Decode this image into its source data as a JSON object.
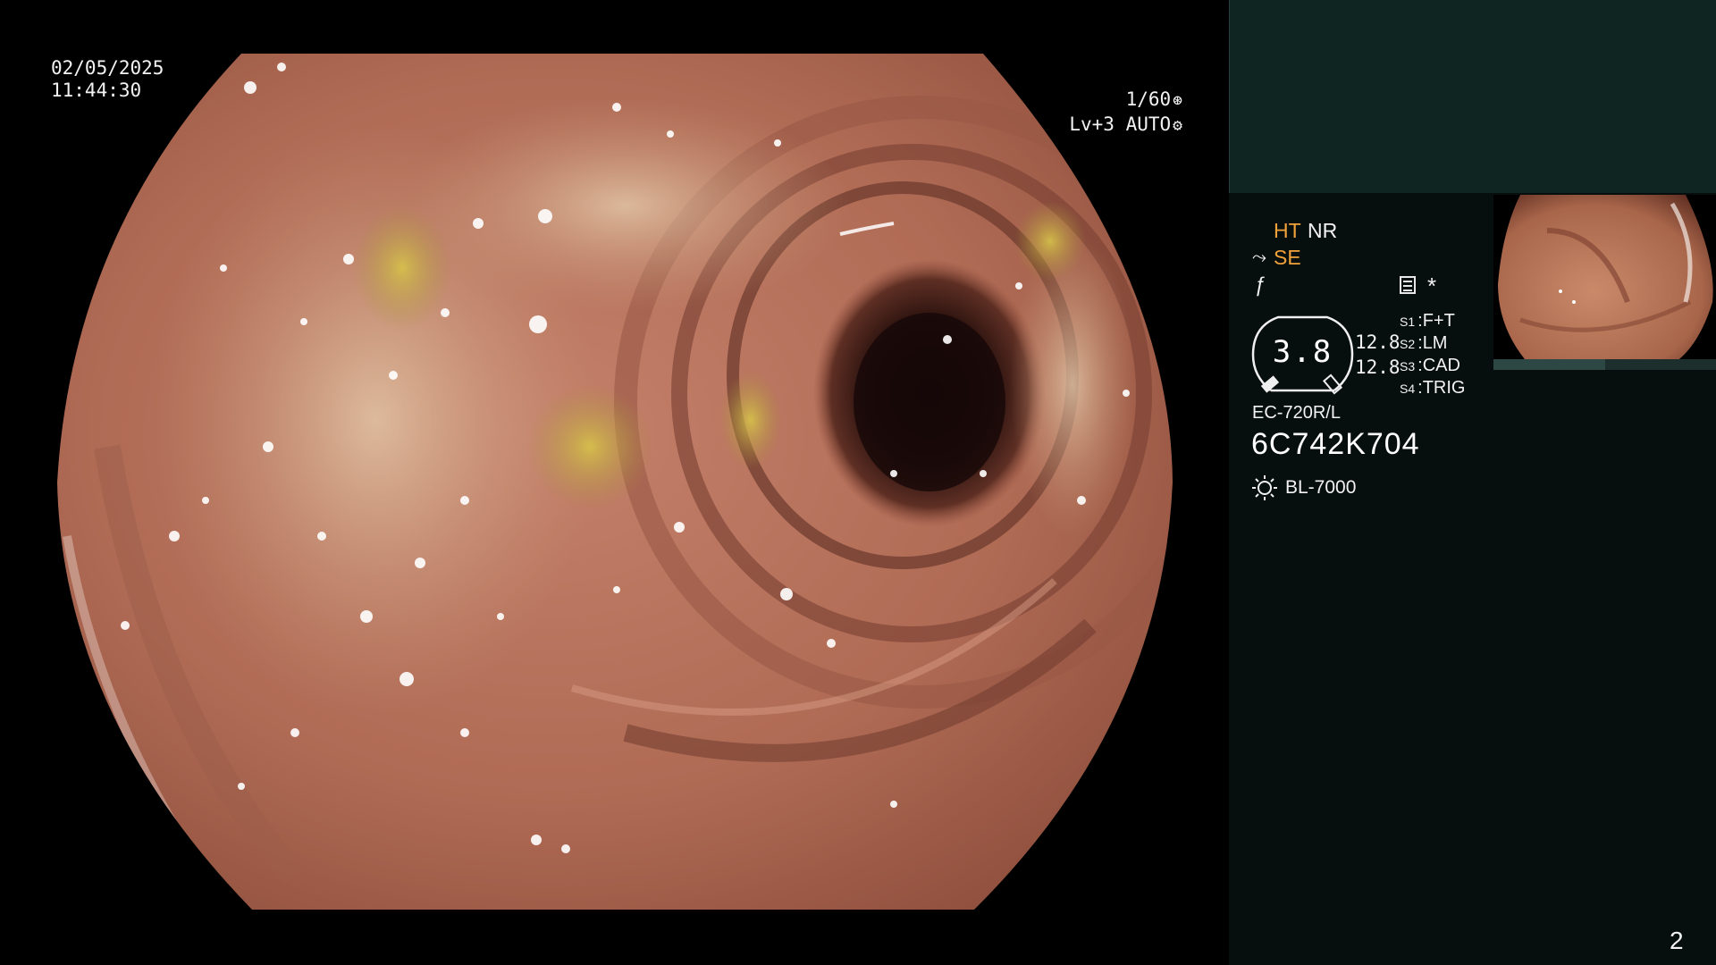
{
  "overlay": {
    "date": "02/05/2025",
    "time": "11:44:30",
    "shutter": "1/60",
    "enhancement": "Lv+3 AUTO"
  },
  "panel": {
    "modes": {
      "ht": "HT",
      "nr": "NR",
      "se": "SE",
      "colors": {
        "active": "#f2a23a",
        "inactive": "#f2f2f2"
      }
    },
    "status_star": "*",
    "gauge_value": "3.8",
    "side_values": [
      "12.8",
      "12.8"
    ],
    "switches": [
      {
        "key": "S1",
        "label": "F+T"
      },
      {
        "key": "S2",
        "label": "LM"
      },
      {
        "key": "S3",
        "label": "CAD"
      },
      {
        "key": "S4",
        "label": "TRIG"
      }
    ],
    "scope_model": "EC-720R/L",
    "scope_serial": "6C742K704",
    "light_source": "BL-7000",
    "page_number": "2"
  },
  "icons": {
    "shutter": "shutter-icon",
    "enhancement": "gear-icon",
    "se_mode": "scissors-icon",
    "f_mode": "f-icon",
    "status": "record-icon",
    "light": "lamp-icon"
  },
  "colors": {
    "panel_top": "#0f2522",
    "panel_bottom": "#070f0e",
    "accent": "#f2a23a"
  }
}
